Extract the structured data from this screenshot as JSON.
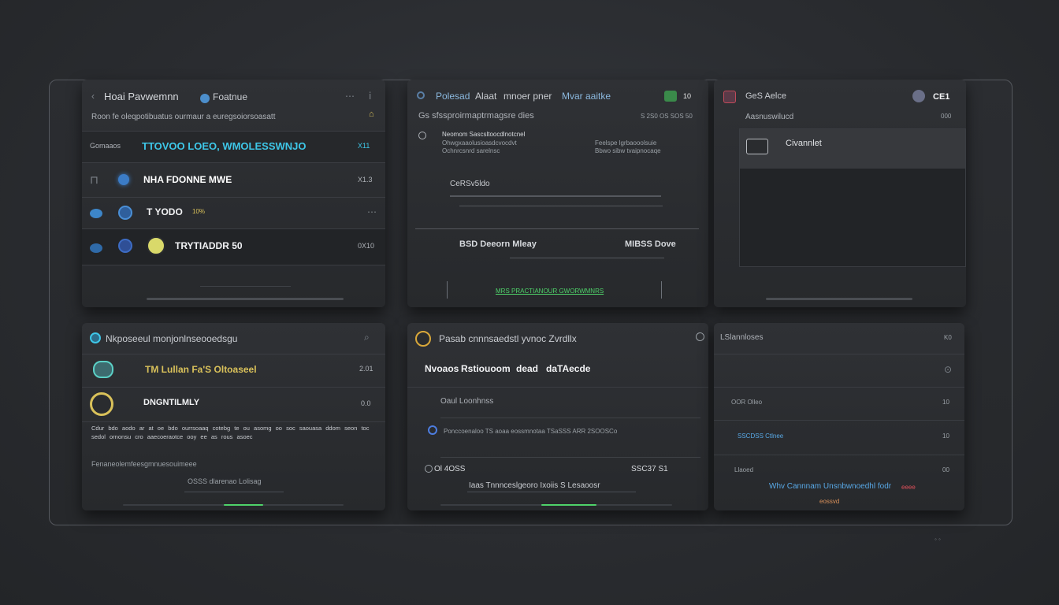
{
  "panels": {
    "p1": {
      "title": "Hoai Pavwemnn",
      "title_suffix": "Foatnue",
      "subtitle": "Roon fe oleqpotibuatus ourmaur a euregsoiorsoasatt",
      "row1_tag": "Gomaaos",
      "row1_title": "TTOVOO LOEO, WMOLESSWNJO",
      "row1_value": "X11",
      "row2_title": "NHA FDONNE MWE",
      "row2_value": "X1.3",
      "row3_title": "T YODO",
      "row3_badge": "10%",
      "row4_title": "TRYTIADDR 50",
      "row4_value": "0X10"
    },
    "p2": {
      "title": "Polesad",
      "title_2": "Alaat",
      "title_3": "mnoer pner",
      "title_4": "Mvar aaitke",
      "header_right": "10",
      "subtitle": "Gs sfssproirmaptrmagsre dies",
      "subtitle_right": "S 2S0 OS SOS 50",
      "item_a1": "Neomom Sascsltoocdlnotcnel",
      "item_a2": "Ohwgxaaolusioasdcvocdvt",
      "item_a3": "Ochnrcsnrd sarelnsc",
      "item_b1": "Feelspe lgrbaooolsuie",
      "item_b2": "Bbwo sibw tvaipnocaqe",
      "label_c": "CeRSv5ldo",
      "footer_left": "BSD Deeorn Mleay",
      "footer_right": "MIBSS Dove",
      "link": "MRS PRACTIANOUR GWORWMNRS"
    },
    "p3": {
      "title": "GeS Aelce",
      "header_right": "CE1",
      "subtitle": "Aasnuswilucd",
      "subtitle_right": "000",
      "selected_label": "Civannlet"
    },
    "p4": {
      "title": "Nkposeeul monjonlnseooedsgu",
      "row1_title": "TM Lullan Fa'S Oltoaseel",
      "row1_value": "2.01",
      "row2_title": "DNGNTILMLY",
      "row2_value": "0.0",
      "paragraph": "Cdur bdo aodo ar at oe bdo  ourrsoaaq  cotebg te ou asomg oo soc saouasa ddom seon toc sedol ornonsu  cro aaecoeraotce ooy ee as rous asoec",
      "footer_text": "Fenaneolemfeesgmnuesouimeee",
      "footer_link": "OSSS dlarenao Lolisag"
    },
    "p5": {
      "title": "Pasab cnnnsaedstl yvnoc Zvrdllx",
      "row1_title": "Nvoaos",
      "row1_title_2": "Rstiouoom",
      "row1_title_3": "dead",
      "row1_title_4": "daTAecde",
      "label_a": "Oaul Loonhnss",
      "row2_text": "Ponccoenaloo TS aoaa  eossmnotaa  TSaSSS  ARR  2SOOSCo",
      "row3_left": "Ol 4OSS",
      "row3_right": "SSC37 S1",
      "footer_text": "Iaas Tnnnceslgeoro Ixoiis S Lesaoosr"
    },
    "p6": {
      "title": "LSlannloses",
      "header_right": "K0",
      "row1_left": "OOR Olleo",
      "row1_value": "10",
      "row2_left": "SSCDSS Ctlnee",
      "row2_value": "10",
      "row3_left": "Llaoed",
      "row3_value": "00",
      "footer_text": "Whv Cannnam Unsnbwnoedhl fodr",
      "footer_tag": "eeee",
      "footer_small": "eossvd"
    }
  },
  "colors": {
    "accent_cyan": "#3ec7e8",
    "accent_yellow": "#d9c15a",
    "accent_green": "#4fd36a",
    "accent_blue": "#58a8e6",
    "accent_red": "#e0505a"
  }
}
